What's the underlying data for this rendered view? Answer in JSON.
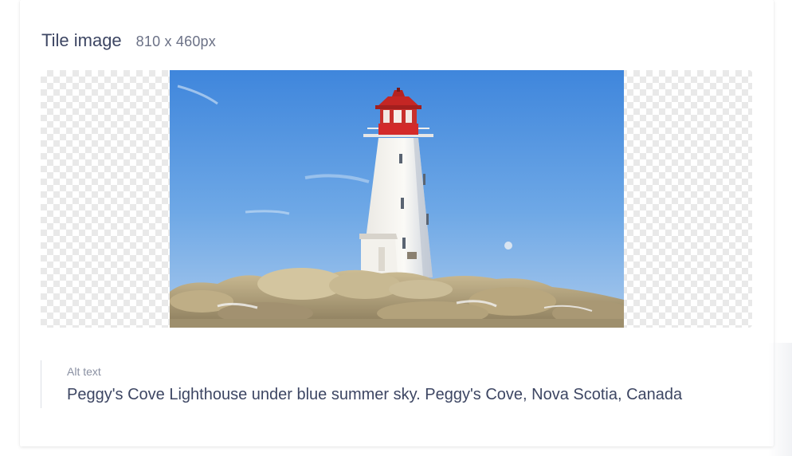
{
  "tile": {
    "title": "Tile image",
    "dimensions": "810 x 460px"
  },
  "image": {
    "subject": "lighthouse-photo",
    "sky_color": "#4f93e0",
    "lamp_color": "#d32a2a"
  },
  "alt": {
    "label": "Alt text",
    "value": "Peggy's Cove Lighthouse under blue summer sky. Peggy's Cove, Nova Scotia, Canada"
  }
}
